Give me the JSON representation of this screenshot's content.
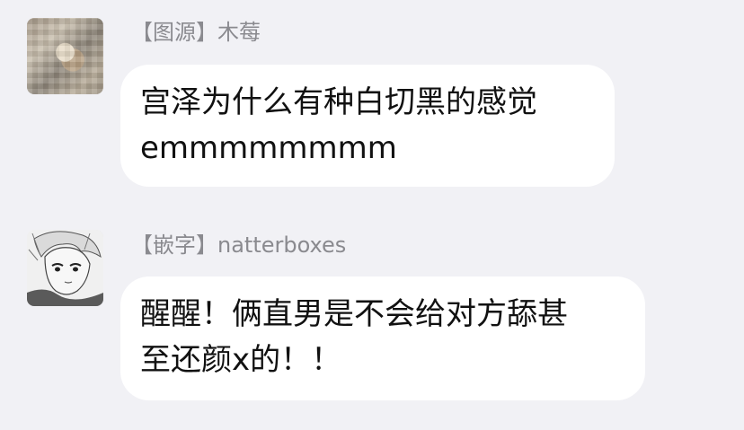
{
  "messages": [
    {
      "sender": "【图源】木莓",
      "text": "宫泽为什么有种白切黑的感觉\nemmmmmmmm",
      "avatar_icon": "user-avatar"
    },
    {
      "sender": "【嵌字】natterboxes",
      "text": "醒醒！俩直男是不会给对方舔甚\n至还颜x的！！",
      "avatar_icon": "user-avatar"
    }
  ]
}
